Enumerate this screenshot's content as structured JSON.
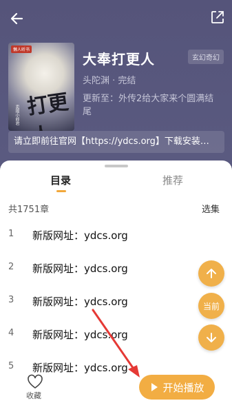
{
  "book": {
    "title": "大奉打更人",
    "author_status": "头陀渊 · 完结",
    "genre": "玄幻奇幻",
    "update": "更新至：外传2给大家来个圆满结尾",
    "cover_badge": "懒人听书",
    "cover_title": "打更人",
    "cover_author": "卖报小郎君"
  },
  "notice": "请立即前往官网【https://ydcs.org】下载安装…",
  "tabs": [
    "目录",
    "推荐"
  ],
  "chapter_count": "共1751章",
  "select_label": "选集",
  "chapters": [
    {
      "num": "1",
      "title": "新版网址：ydcs.org"
    },
    {
      "num": "2",
      "title": "新版网址：ydcs.org"
    },
    {
      "num": "3",
      "title": "新版网址：ydcs.org"
    },
    {
      "num": "4",
      "title": "新版网址：ydcs.org"
    },
    {
      "num": "5",
      "title": "新版网址：ydcs.org"
    }
  ],
  "fab_current_label": "当前",
  "fav_label": "收藏",
  "play_label": "开始播放",
  "colors": {
    "accent": "#f2ad43",
    "header_bg": "#56557a"
  }
}
